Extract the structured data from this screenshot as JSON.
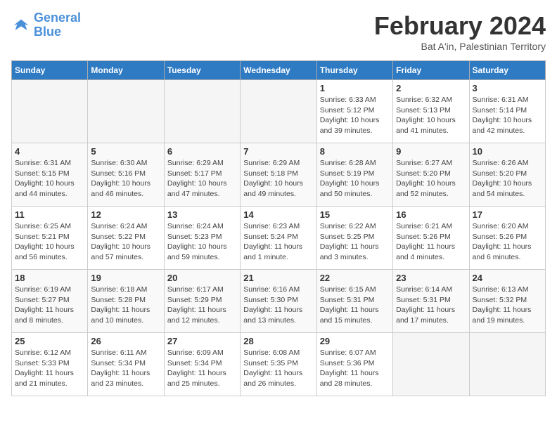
{
  "header": {
    "logo_line1": "General",
    "logo_line2": "Blue",
    "month_title": "February 2024",
    "subtitle": "Bat A'in, Palestinian Territory"
  },
  "weekdays": [
    "Sunday",
    "Monday",
    "Tuesday",
    "Wednesday",
    "Thursday",
    "Friday",
    "Saturday"
  ],
  "weeks": [
    [
      {
        "day": "",
        "info": ""
      },
      {
        "day": "",
        "info": ""
      },
      {
        "day": "",
        "info": ""
      },
      {
        "day": "",
        "info": ""
      },
      {
        "day": "1",
        "info": "Sunrise: 6:33 AM\nSunset: 5:12 PM\nDaylight: 10 hours\nand 39 minutes."
      },
      {
        "day": "2",
        "info": "Sunrise: 6:32 AM\nSunset: 5:13 PM\nDaylight: 10 hours\nand 41 minutes."
      },
      {
        "day": "3",
        "info": "Sunrise: 6:31 AM\nSunset: 5:14 PM\nDaylight: 10 hours\nand 42 minutes."
      }
    ],
    [
      {
        "day": "4",
        "info": "Sunrise: 6:31 AM\nSunset: 5:15 PM\nDaylight: 10 hours\nand 44 minutes."
      },
      {
        "day": "5",
        "info": "Sunrise: 6:30 AM\nSunset: 5:16 PM\nDaylight: 10 hours\nand 46 minutes."
      },
      {
        "day": "6",
        "info": "Sunrise: 6:29 AM\nSunset: 5:17 PM\nDaylight: 10 hours\nand 47 minutes."
      },
      {
        "day": "7",
        "info": "Sunrise: 6:29 AM\nSunset: 5:18 PM\nDaylight: 10 hours\nand 49 minutes."
      },
      {
        "day": "8",
        "info": "Sunrise: 6:28 AM\nSunset: 5:19 PM\nDaylight: 10 hours\nand 50 minutes."
      },
      {
        "day": "9",
        "info": "Sunrise: 6:27 AM\nSunset: 5:20 PM\nDaylight: 10 hours\nand 52 minutes."
      },
      {
        "day": "10",
        "info": "Sunrise: 6:26 AM\nSunset: 5:20 PM\nDaylight: 10 hours\nand 54 minutes."
      }
    ],
    [
      {
        "day": "11",
        "info": "Sunrise: 6:25 AM\nSunset: 5:21 PM\nDaylight: 10 hours\nand 56 minutes."
      },
      {
        "day": "12",
        "info": "Sunrise: 6:24 AM\nSunset: 5:22 PM\nDaylight: 10 hours\nand 57 minutes."
      },
      {
        "day": "13",
        "info": "Sunrise: 6:24 AM\nSunset: 5:23 PM\nDaylight: 10 hours\nand 59 minutes."
      },
      {
        "day": "14",
        "info": "Sunrise: 6:23 AM\nSunset: 5:24 PM\nDaylight: 11 hours\nand 1 minute."
      },
      {
        "day": "15",
        "info": "Sunrise: 6:22 AM\nSunset: 5:25 PM\nDaylight: 11 hours\nand 3 minutes."
      },
      {
        "day": "16",
        "info": "Sunrise: 6:21 AM\nSunset: 5:26 PM\nDaylight: 11 hours\nand 4 minutes."
      },
      {
        "day": "17",
        "info": "Sunrise: 6:20 AM\nSunset: 5:26 PM\nDaylight: 11 hours\nand 6 minutes."
      }
    ],
    [
      {
        "day": "18",
        "info": "Sunrise: 6:19 AM\nSunset: 5:27 PM\nDaylight: 11 hours\nand 8 minutes."
      },
      {
        "day": "19",
        "info": "Sunrise: 6:18 AM\nSunset: 5:28 PM\nDaylight: 11 hours\nand 10 minutes."
      },
      {
        "day": "20",
        "info": "Sunrise: 6:17 AM\nSunset: 5:29 PM\nDaylight: 11 hours\nand 12 minutes."
      },
      {
        "day": "21",
        "info": "Sunrise: 6:16 AM\nSunset: 5:30 PM\nDaylight: 11 hours\nand 13 minutes."
      },
      {
        "day": "22",
        "info": "Sunrise: 6:15 AM\nSunset: 5:31 PM\nDaylight: 11 hours\nand 15 minutes."
      },
      {
        "day": "23",
        "info": "Sunrise: 6:14 AM\nSunset: 5:31 PM\nDaylight: 11 hours\nand 17 minutes."
      },
      {
        "day": "24",
        "info": "Sunrise: 6:13 AM\nSunset: 5:32 PM\nDaylight: 11 hours\nand 19 minutes."
      }
    ],
    [
      {
        "day": "25",
        "info": "Sunrise: 6:12 AM\nSunset: 5:33 PM\nDaylight: 11 hours\nand 21 minutes."
      },
      {
        "day": "26",
        "info": "Sunrise: 6:11 AM\nSunset: 5:34 PM\nDaylight: 11 hours\nand 23 minutes."
      },
      {
        "day": "27",
        "info": "Sunrise: 6:09 AM\nSunset: 5:34 PM\nDaylight: 11 hours\nand 25 minutes."
      },
      {
        "day": "28",
        "info": "Sunrise: 6:08 AM\nSunset: 5:35 PM\nDaylight: 11 hours\nand 26 minutes."
      },
      {
        "day": "29",
        "info": "Sunrise: 6:07 AM\nSunset: 5:36 PM\nDaylight: 11 hours\nand 28 minutes."
      },
      {
        "day": "",
        "info": ""
      },
      {
        "day": "",
        "info": ""
      }
    ]
  ]
}
